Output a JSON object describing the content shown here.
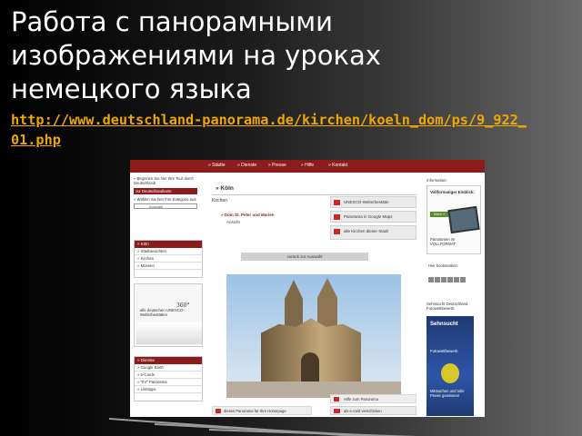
{
  "slide": {
    "title": "Работа с панорамными изображениями на уроках немецкого языка",
    "link": "http://www.deutschland-panorama.de/kirchen/koeln_dom/ps/9_922_01.php"
  },
  "screenshot": {
    "topnav": [
      "» Städte",
      "» Dienste",
      "» Presse",
      "» Hilfe",
      "» Kontakt"
    ],
    "left": {
      "intro": "» Beginnen Sie hier Ihre Tour durch Deutschland!",
      "intro_button": "zur Deutschlandkarte",
      "choose": "» Wählen Sie hier Ihre Kategorie aus:",
      "select_value": "Auswahl",
      "nav": {
        "header": "» Köln",
        "items": [
          "» Stadtansichten",
          "» Kirchen",
          "» Museen"
        ]
      },
      "unesco_text": "alle deutschen UNESCO-Welterbestätten",
      "unesco_mark": "360°",
      "unesco_more": "Mehr »",
      "services": {
        "header": "» Dienste",
        "items": [
          "» Google Earth",
          "» e-Cards",
          "» \"Ihr\" Panorama",
          "» Linktipps"
        ]
      }
    },
    "main": {
      "city": "» Köln",
      "section": "Kirchen",
      "place": "» Dom St. Peter und Marien",
      "view": "Ansicht",
      "buttons": [
        "UNESCO-Welterbestätte",
        "Panorama in Google Maps",
        "alle Kirchen dieser Stadt"
      ],
      "back": "zurück zur Auswahl",
      "footer_left": "dieses Panorama für Ihre Homepage",
      "footer_right_1": "Hilfe zum Panorama",
      "footer_right_2": "als e-card verschicken"
    },
    "right": {
      "info": "Information:",
      "promo_title": "Vollformatiger Einblick:",
      "promo_more": "Mehr »",
      "promo_sub": "Panoramen im VOLLFORMAT",
      "bookmarks": "Hier bookmarken:",
      "sehnsucht": "Sehnsucht Deutschland Fotowettbewerb",
      "banner_title": "Sehnsucht",
      "banner_sub": "Fotowettbewerb",
      "banner_cta": "Mitmachen und tolle Preise gewinnen!"
    }
  }
}
